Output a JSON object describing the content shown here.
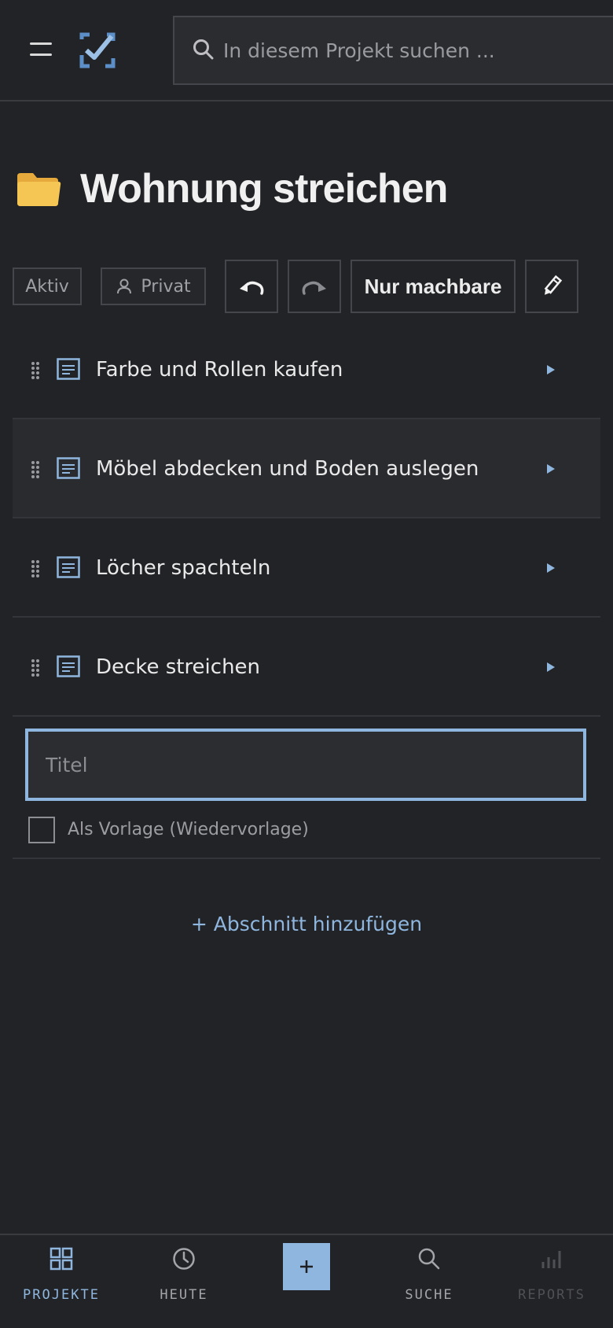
{
  "header": {
    "search_placeholder": "In diesem Projekt suchen ..."
  },
  "project": {
    "title": "Wohnung streichen"
  },
  "toolbar": {
    "status_label": "Aktiv",
    "visibility_label": "Privat",
    "filter_label": "Nur machbare"
  },
  "tasks": [
    {
      "label": "Farbe und Rollen kaufen"
    },
    {
      "label": "Möbel abdecken und Boden auslegen"
    },
    {
      "label": "Löcher spachteln"
    },
    {
      "label": "Decke streichen"
    }
  ],
  "new_task": {
    "title_placeholder": "Titel",
    "template_label": "Als Vorlage (Wiedervorlage)"
  },
  "add_section_label": "+ Abschnitt hinzufügen",
  "bottom_nav": {
    "projects": "PROJEKTE",
    "today": "HEUTE",
    "search": "SUCHE",
    "reports": "REPORTS"
  },
  "colors": {
    "background": "#222326",
    "accent": "#8fb6de",
    "folder": "#f2c14e"
  }
}
